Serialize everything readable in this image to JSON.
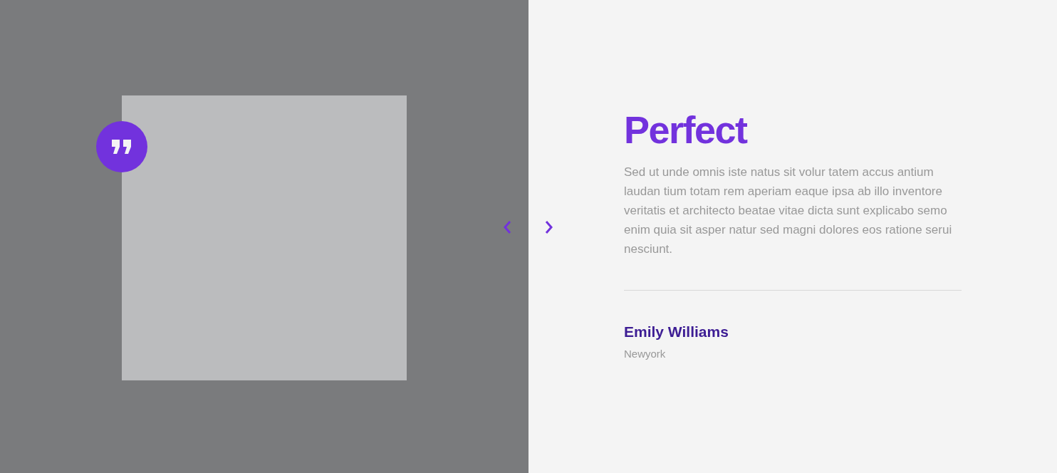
{
  "testimonial": {
    "title": "Perfect",
    "quote": "Sed ut unde omnis iste natus sit volur tatem accus antium laudan tium totam rem aperiam eaque ipsa ab illo inventore veritatis et architecto beatae vitae dicta sunt explicabo semo enim quia sit asper natur sed magni dolores eos ratione serui nesciunt.",
    "author": "Emily Williams",
    "location": "Newyork"
  }
}
